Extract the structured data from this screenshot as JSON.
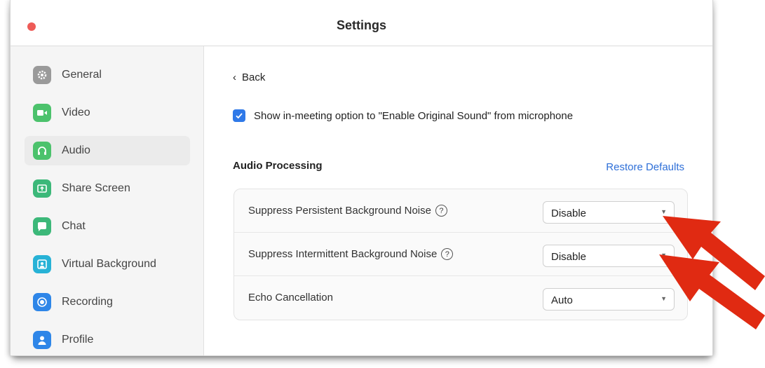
{
  "window": {
    "title": "Settings",
    "close_color": "#ee5b57"
  },
  "sidebar": {
    "items": [
      {
        "label": "General",
        "icon": "gear-icon",
        "color": "#9a9a9a",
        "active": false
      },
      {
        "label": "Video",
        "icon": "camera-icon",
        "color": "#4cc26c",
        "active": false
      },
      {
        "label": "Audio",
        "icon": "headphones-icon",
        "color": "#4cc26c",
        "active": true
      },
      {
        "label": "Share Screen",
        "icon": "share-screen-icon",
        "color": "#3cb879",
        "active": false
      },
      {
        "label": "Chat",
        "icon": "chat-bubble-icon",
        "color": "#3cb879",
        "active": false
      },
      {
        "label": "Virtual Background",
        "icon": "person-background-icon",
        "color": "#27b2d6",
        "active": false
      },
      {
        "label": "Recording",
        "icon": "record-icon",
        "color": "#2e86e8",
        "active": false
      },
      {
        "label": "Profile",
        "icon": "profile-icon",
        "color": "#2e86e8",
        "active": false
      }
    ]
  },
  "main": {
    "back_label": "Back",
    "original_sound_checkbox": {
      "checked": true,
      "label": "Show in-meeting option to \"Enable Original Sound\" from microphone"
    },
    "section_title": "Audio Processing",
    "restore_label": "Restore Defaults",
    "rows": [
      {
        "label": "Suppress Persistent Background Noise",
        "help": true,
        "value": "Disable"
      },
      {
        "label": "Suppress Intermittent Background Noise",
        "help": true,
        "value": "Disable"
      },
      {
        "label": "Echo Cancellation",
        "help": false,
        "value": "Auto"
      }
    ]
  },
  "colors": {
    "accent": "#2f79e8",
    "link": "#2e6fd8",
    "annotation_arrow": "#e02a12"
  }
}
